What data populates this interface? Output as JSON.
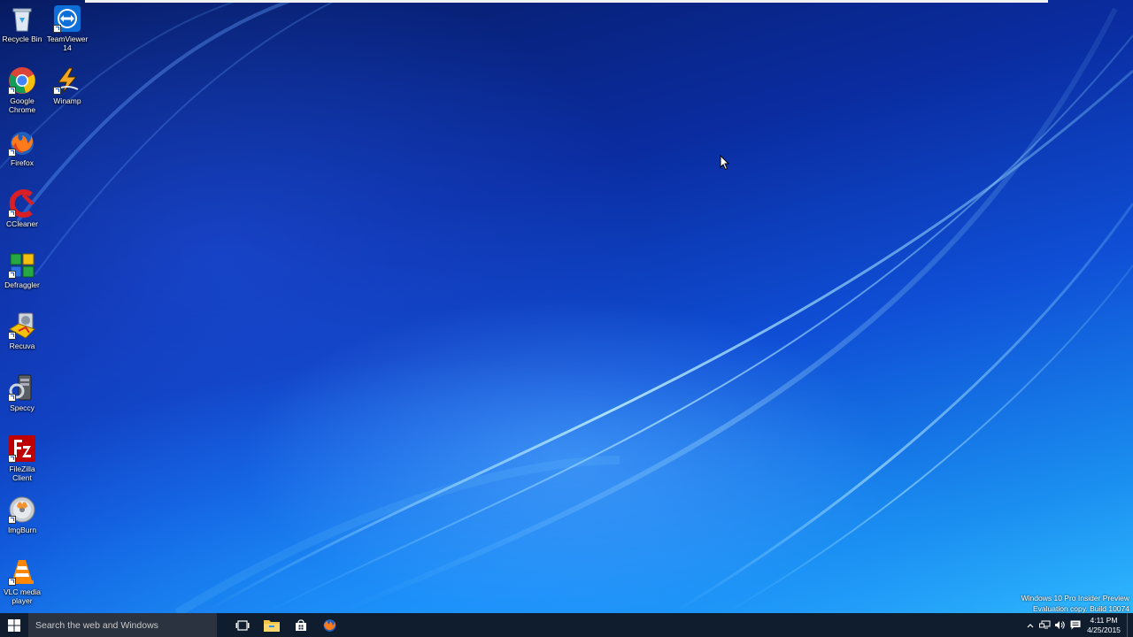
{
  "desktop_icons": [
    {
      "label": "Recycle Bin",
      "icon": "recycle-bin-icon"
    },
    {
      "label": "TeamViewer 14",
      "icon": "teamviewer-icon"
    },
    {
      "label": "Google Chrome",
      "icon": "chrome-icon"
    },
    {
      "label": "Winamp",
      "icon": "winamp-icon"
    },
    {
      "label": "Firefox",
      "icon": "firefox-icon"
    },
    {
      "label": "CCleaner",
      "icon": "ccleaner-icon"
    },
    {
      "label": "Defraggler",
      "icon": "defraggler-icon"
    },
    {
      "label": "Recuva",
      "icon": "recuva-icon"
    },
    {
      "label": "Speccy",
      "icon": "speccy-icon"
    },
    {
      "label": "FileZilla Client",
      "icon": "filezilla-icon"
    },
    {
      "label": "ImgBurn",
      "icon": "imgburn-icon"
    },
    {
      "label": "VLC media player",
      "icon": "vlc-icon"
    }
  ],
  "watermark": {
    "line1": "Windows 10 Pro Insider Preview",
    "line2": "Evaluation copy. Build 10074"
  },
  "taskbar": {
    "search_placeholder": "Search the web and Windows",
    "pinned": [
      "task-view-icon",
      "file-explorer-icon",
      "store-icon",
      "firefox-icon"
    ],
    "clock_time": "4:11 PM",
    "clock_date": "4/25/2015"
  },
  "colors": {
    "taskbar": "#0f1d2e",
    "search_box": "#2b3340",
    "desktop_top": "#061a5e",
    "desktop_bottom": "#2fb8ff"
  }
}
